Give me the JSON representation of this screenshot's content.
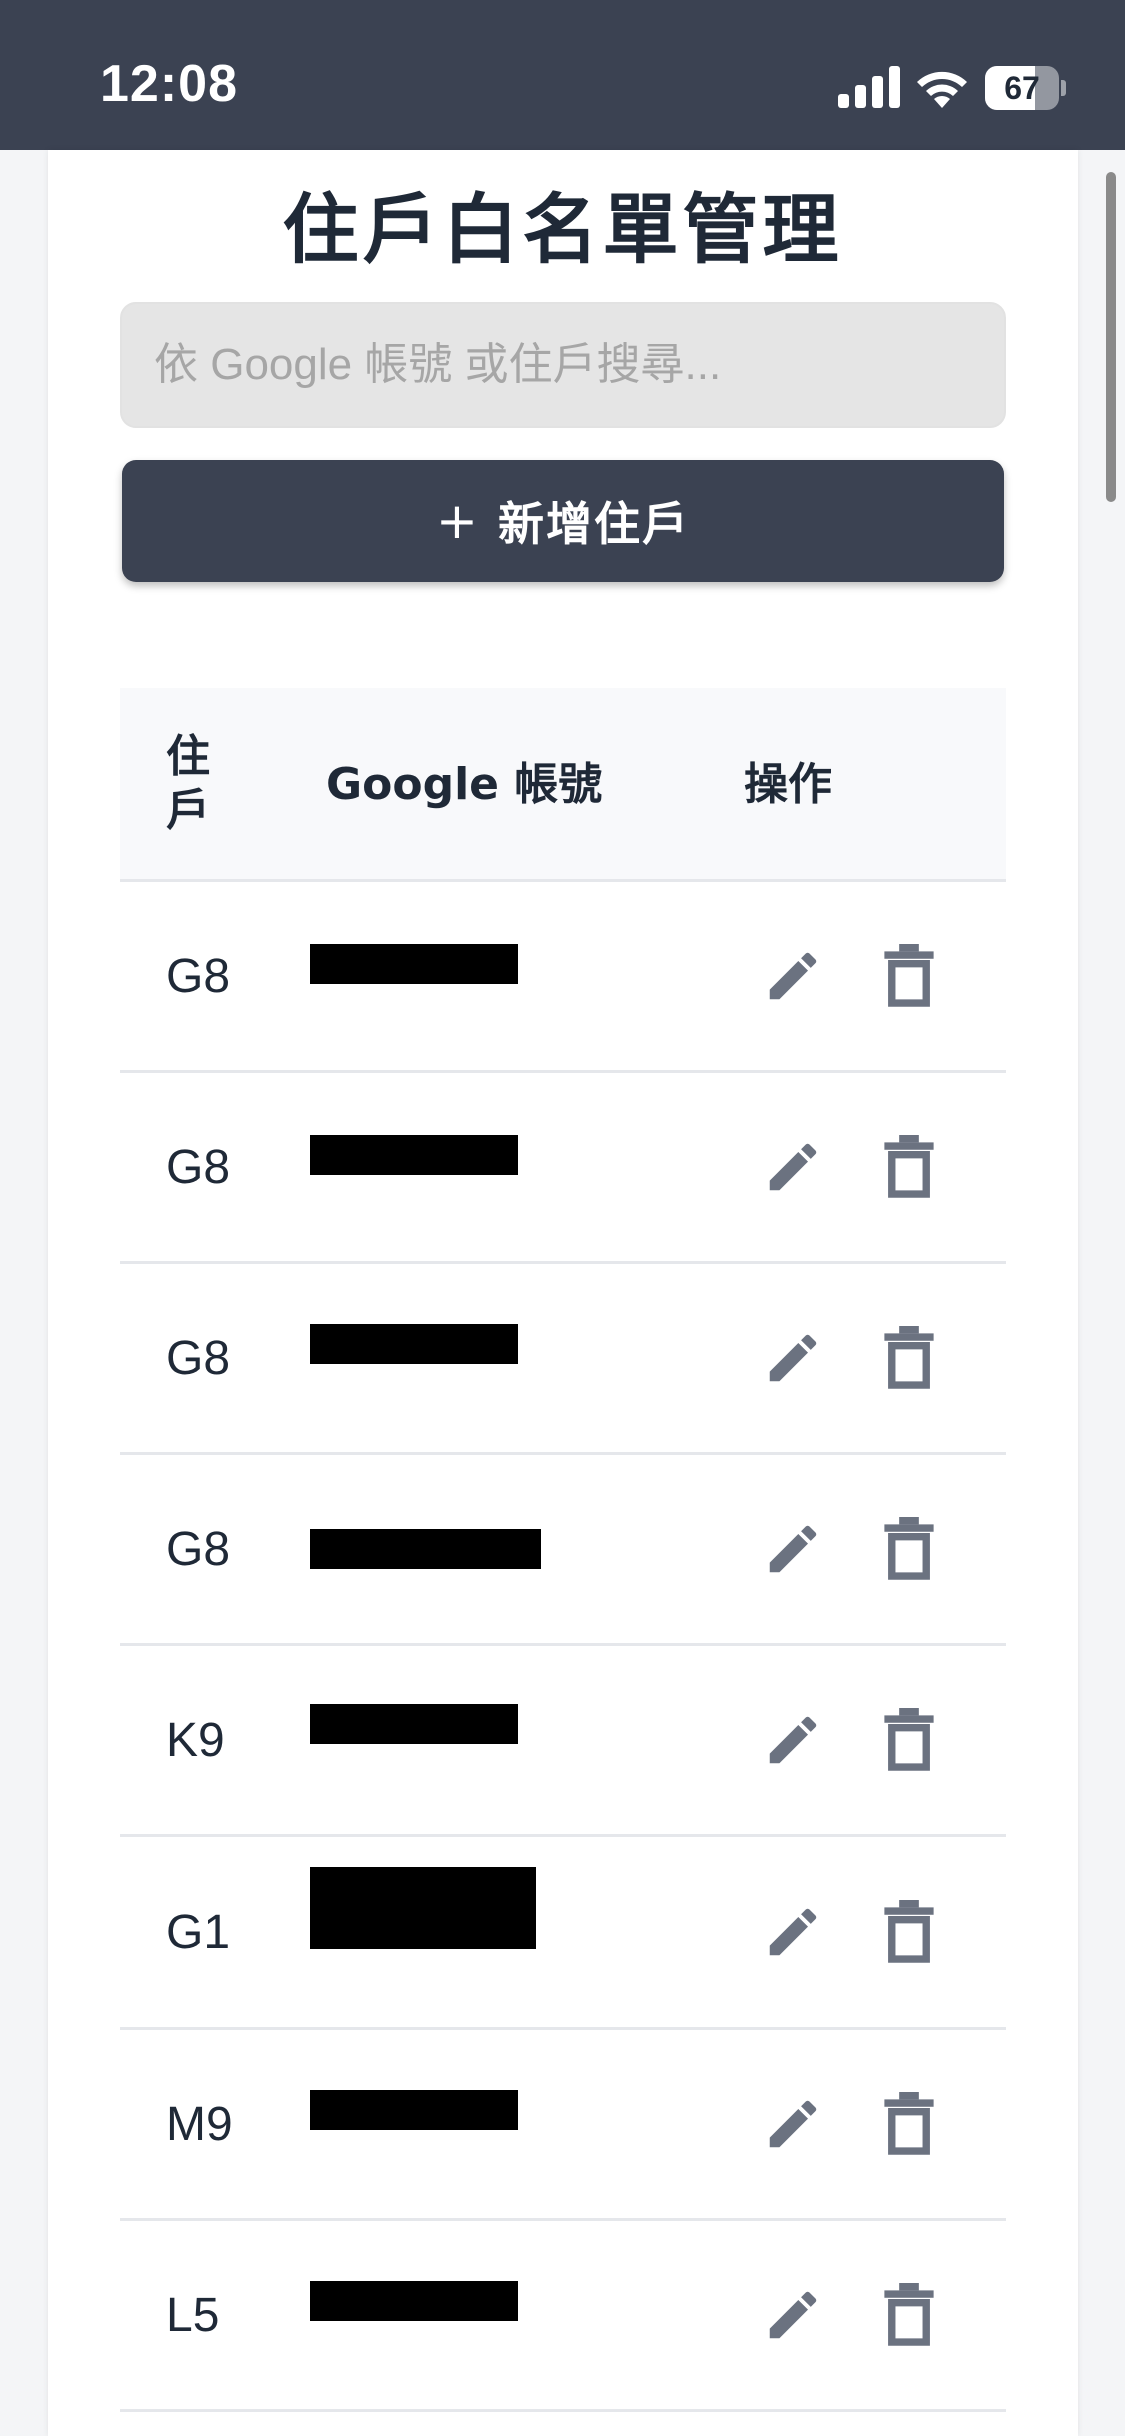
{
  "status_bar": {
    "time": "12:08",
    "battery_percent": "67",
    "battery_level": 0.67,
    "icons": [
      "cellular-signal-icon",
      "wifi-icon",
      "battery-icon"
    ]
  },
  "page": {
    "title": "住戶白名單管理",
    "search_placeholder": "依 Google 帳號 或住戶搜尋...",
    "search_value": "",
    "add_button_icon": "+",
    "add_button_label": "新增住戶"
  },
  "table": {
    "headers": {
      "unit_line1": "住",
      "unit_line2": "戶",
      "email": "Google 帳號",
      "actions": "操作"
    },
    "rows": [
      {
        "unit": "G8",
        "email": "[redacted]"
      },
      {
        "unit": "G8",
        "email": "[redacted]"
      },
      {
        "unit": "G8",
        "email": "[redacted]"
      },
      {
        "unit": "G8",
        "email": "[redacted]"
      },
      {
        "unit": "K9",
        "email": "[redacted]"
      },
      {
        "unit": "G1",
        "email": "[redacted]"
      },
      {
        "unit": "M9",
        "email": "[redacted]"
      },
      {
        "unit": "L5",
        "email": "[redacted]"
      }
    ],
    "row_actions": [
      "edit-pencil-icon",
      "trash-icon"
    ]
  },
  "colors": {
    "header_bg": "#3b4252",
    "button_bg": "#3b4252",
    "icon_gray": "#6b7280",
    "redaction": "#000000"
  }
}
